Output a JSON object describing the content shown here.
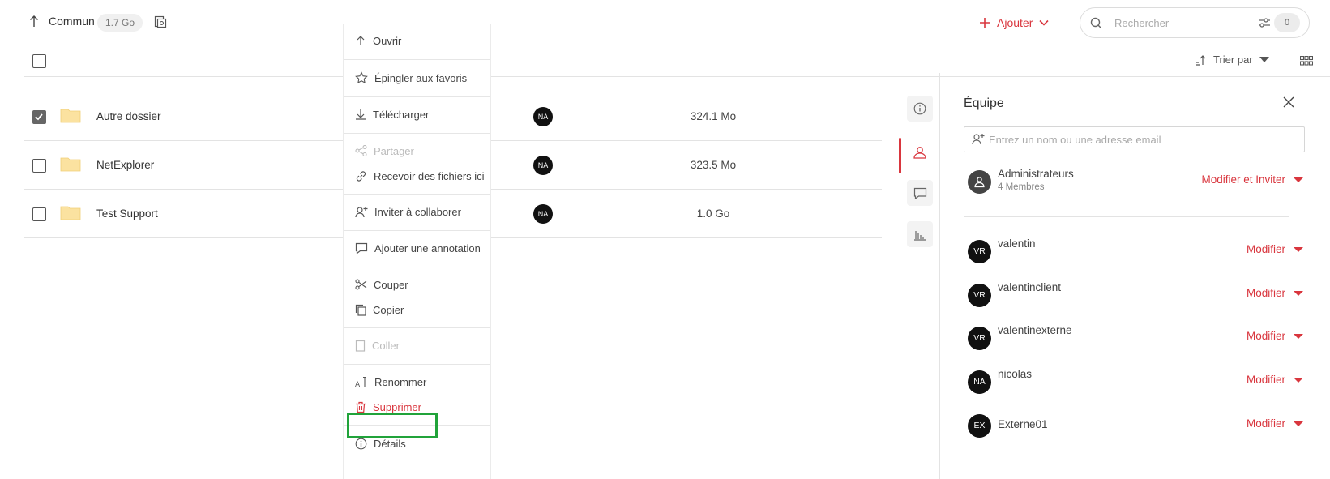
{
  "breadcrumb": {
    "label": "Commun",
    "size": "1.7 Go"
  },
  "header": {
    "add_label": "Ajouter",
    "search_placeholder": "Rechercher",
    "filter_count": "0"
  },
  "toolbar": {
    "sort_label": "Trier par"
  },
  "files": [
    {
      "name": "Autre dossier",
      "owner": "NA",
      "size": "324.1 Mo",
      "checked": true
    },
    {
      "name": "NetExplorer",
      "owner": "NA",
      "size": "323.5 Mo",
      "checked": false
    },
    {
      "name": "Test Support",
      "owner": "NA",
      "size": "1.0 Go",
      "checked": false
    }
  ],
  "context_menu": {
    "open": "Ouvrir",
    "pin": "Épingler aux favoris",
    "download": "Télécharger",
    "share": "Partager",
    "receive": "Recevoir des fichiers ici",
    "invite": "Inviter à collaborer",
    "annotate": "Ajouter une annotation",
    "cut": "Couper",
    "copy": "Copier",
    "paste": "Coller",
    "rename": "Renommer",
    "delete": "Supprimer",
    "details": "Détails"
  },
  "team_panel": {
    "title": "Équipe",
    "invite_placeholder": "Entrez un nom ou une adresse email",
    "group": {
      "name": "Administrateurs",
      "members": "4 Membres",
      "role": "Modifier et Inviter"
    },
    "members": [
      {
        "initials": "VR",
        "name": "valentin",
        "role": "Modifier"
      },
      {
        "initials": "VR",
        "name": "valentinclient",
        "role": "Modifier"
      },
      {
        "initials": "VR",
        "name": "valentinexterne",
        "role": "Modifier"
      },
      {
        "initials": "NA",
        "name": "nicolas",
        "role": "Modifier"
      },
      {
        "initials": "EX",
        "name": "Externe01",
        "role": "Modifier"
      }
    ]
  },
  "colors": {
    "accent": "#d9363e",
    "highlight": "#21a33a",
    "folder": "#fbe2a0"
  }
}
